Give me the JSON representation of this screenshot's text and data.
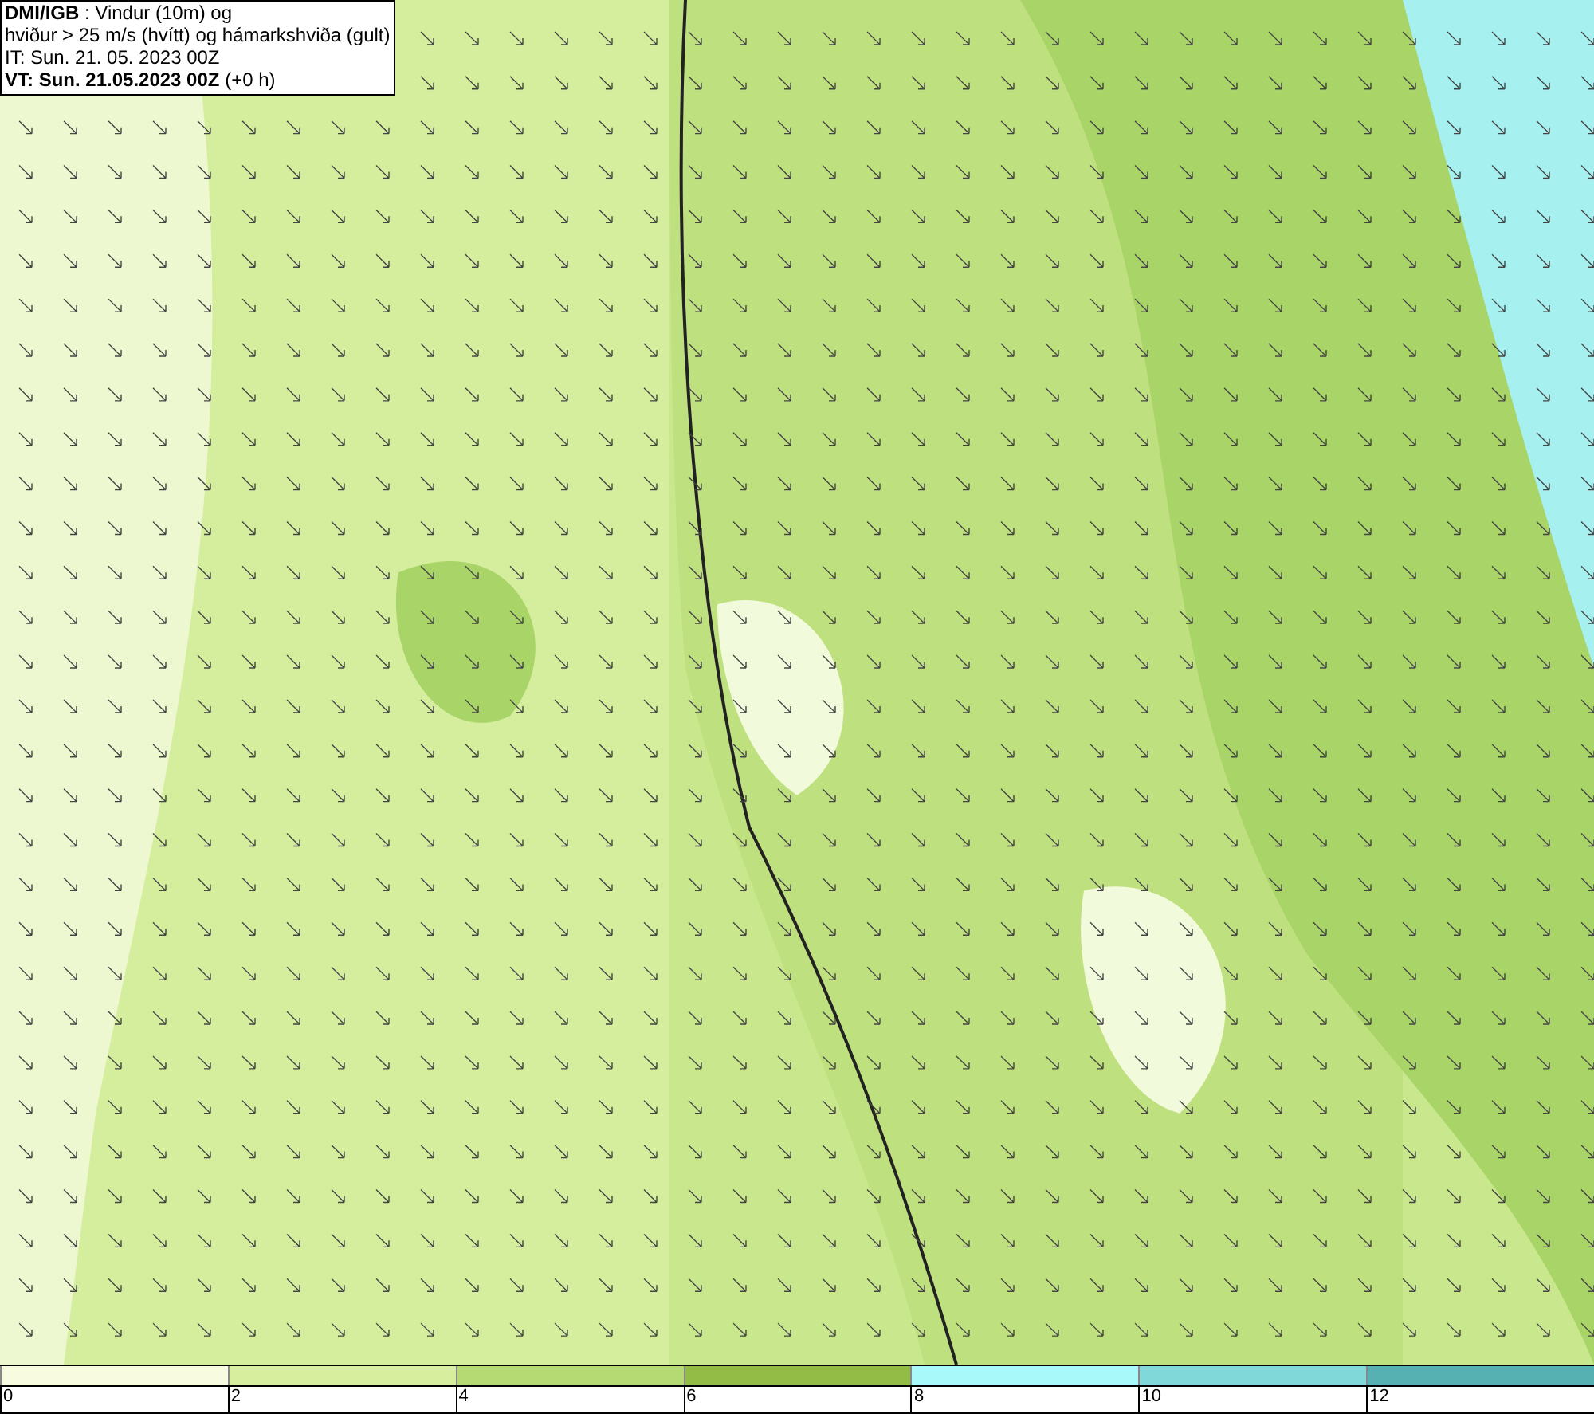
{
  "header": {
    "lines": [
      "**DMI/IGB** : Vindur (10m) og",
      "hviður > 25 m/s (hvítt) og hámarkshviða (gult)",
      "IT: Sun. 21. 05. 2023 00Z",
      "**VT: Sun. 21.05.2023 00Z** (+0 h)"
    ]
  },
  "legend": {
    "bins": [
      {
        "label": "0",
        "color": "#f7fbe0"
      },
      {
        "label": "2",
        "color": "#d6ee9e"
      },
      {
        "label": "4",
        "color": "#b5da74"
      },
      {
        "label": "6",
        "color": "#93bc46"
      },
      {
        "label": "8",
        "color": "#a8fafa"
      },
      {
        "label": "10",
        "color": "#80d8d8"
      },
      {
        "label": "12",
        "color": "#56b2b2"
      }
    ]
  }
}
